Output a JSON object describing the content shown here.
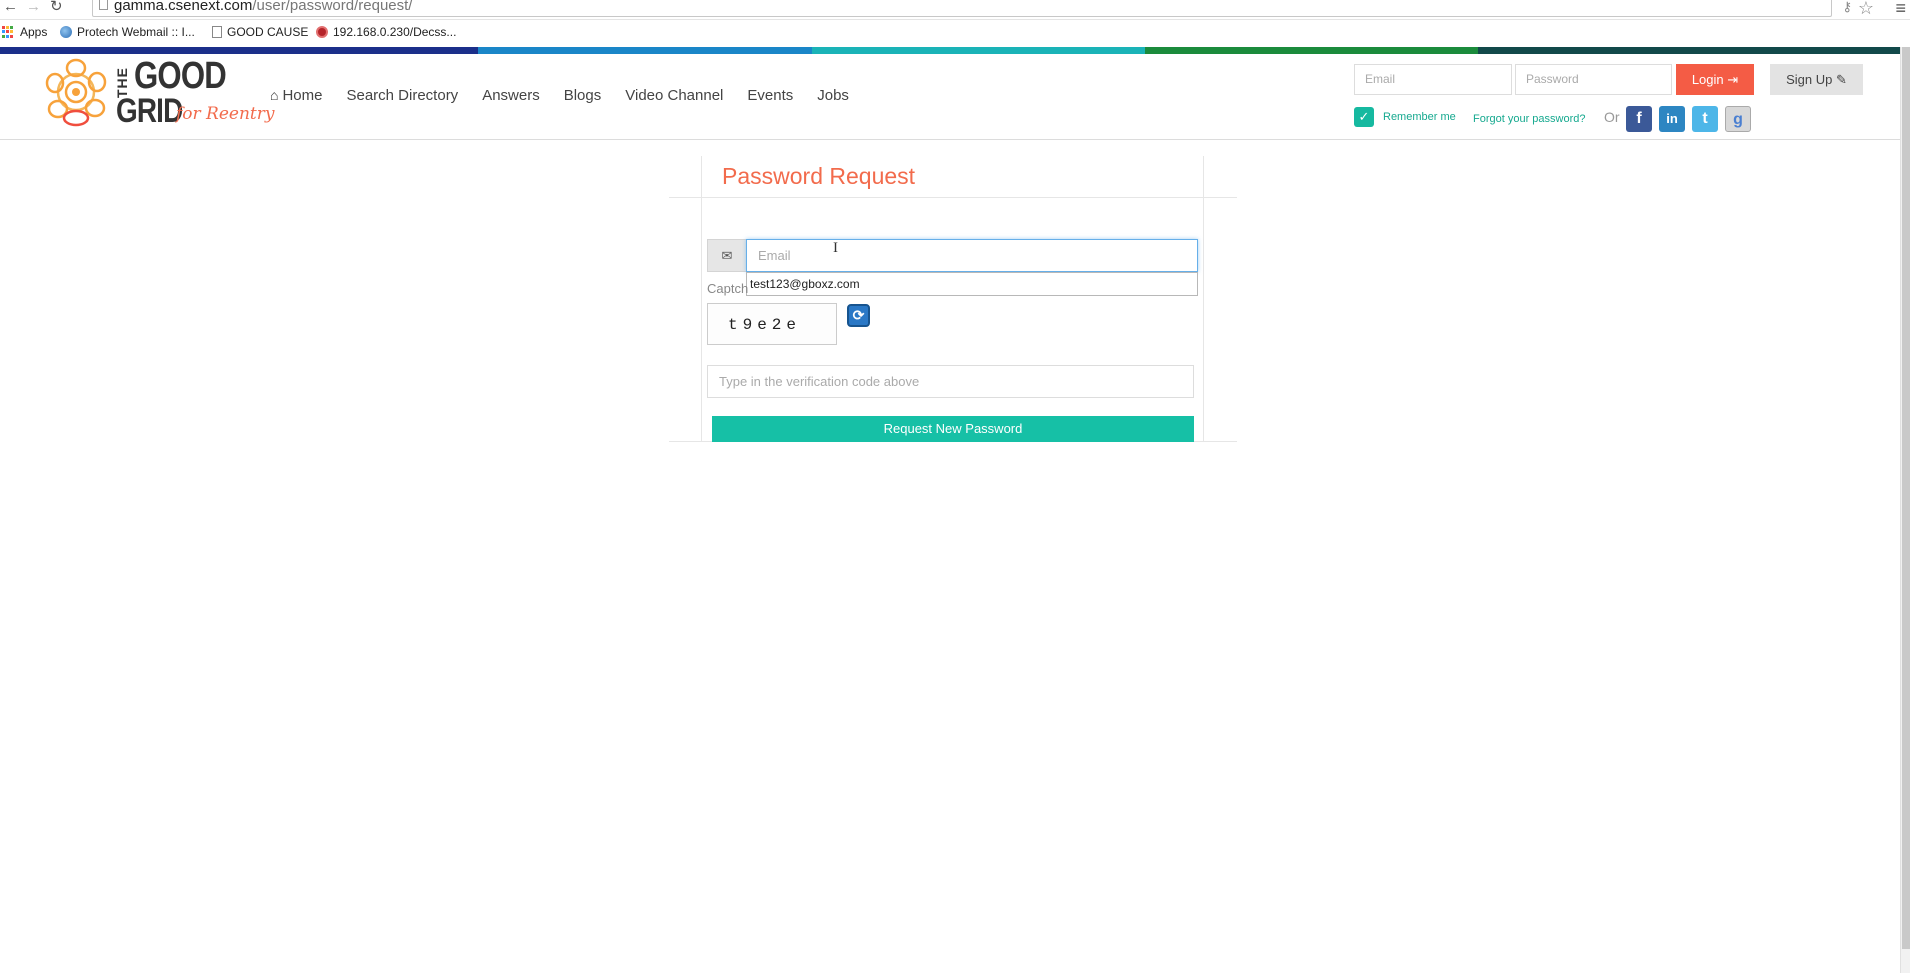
{
  "browser": {
    "url_host": "gamma.csenext.com",
    "url_path": "/user/password/request/",
    "bookmarks": [
      {
        "label": "Apps",
        "icon": "apps-grid-icon"
      },
      {
        "label": "Protech Webmail :: I...",
        "icon": "webmail-icon"
      },
      {
        "label": "GOOD CAUSE",
        "icon": "page-icon"
      },
      {
        "label": "192.168.0.230/Decss...",
        "icon": "site-icon"
      }
    ]
  },
  "brand": {
    "logo_the": "THE",
    "logo_good": "GOOD",
    "logo_grid": "GRID",
    "logo_tagline": "for Reentry",
    "accent_color": "#f26b4c",
    "teal_color": "#16c0a6"
  },
  "nav": {
    "items": [
      "Home",
      "Search Directory",
      "Answers",
      "Blogs",
      "Video Channel",
      "Events",
      "Jobs"
    ]
  },
  "header_login": {
    "email_placeholder": "Email",
    "password_placeholder": "Password",
    "login_label": "Login",
    "signup_label": "Sign Up",
    "remember_label": "Remember me",
    "remember_checked": true,
    "forgot_label": "Forgot your password?",
    "or_label": "Or"
  },
  "form": {
    "title": "Password Request",
    "email_placeholder": "Email",
    "autocomplete_suggestion": "test123@gboxz.com",
    "captcha_label": "Captch",
    "captcha_code": "t9e2e",
    "verify_placeholder": "Type in the verification code above",
    "submit_label": "Request New Password"
  }
}
